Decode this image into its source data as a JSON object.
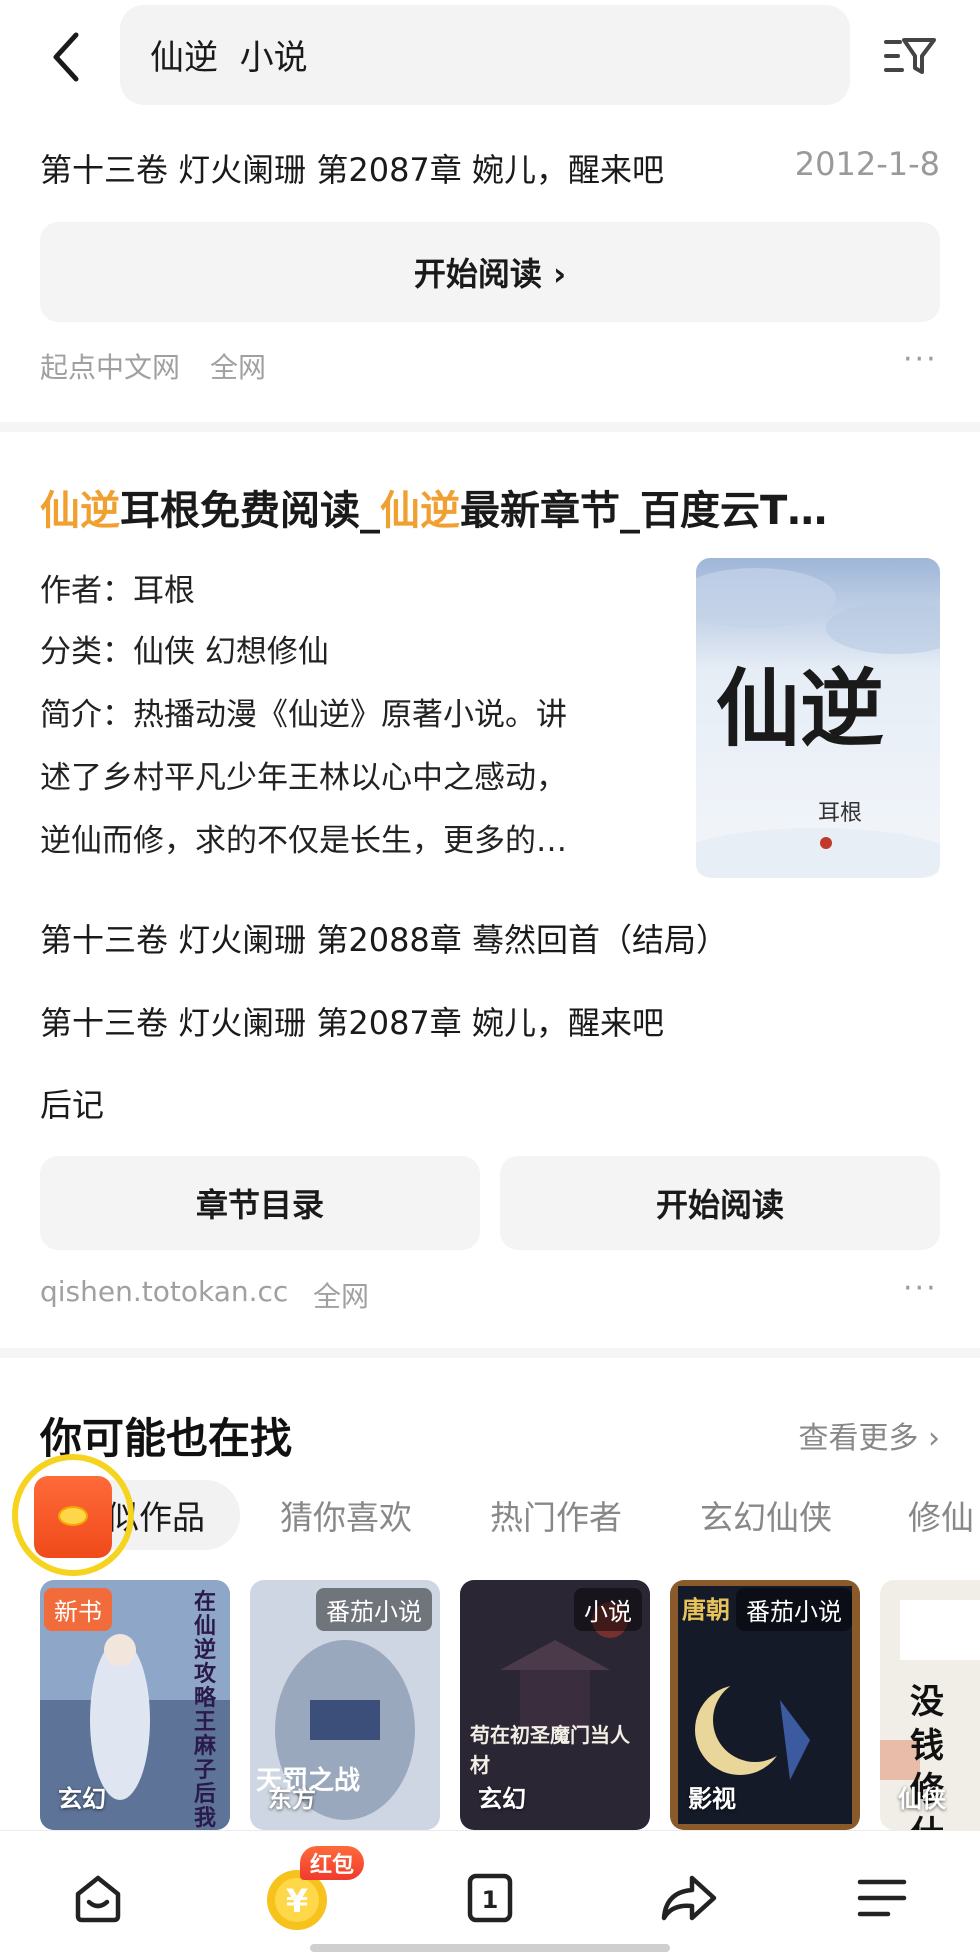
{
  "search": {
    "query": "仙逆  小说"
  },
  "result1": {
    "chapter": "第十三卷 灯火阑珊 第2087章 婉儿，醒来吧",
    "date": "2012-1-8",
    "read_button": "开始阅读 ›",
    "source": "起点中文网",
    "scope": "全网",
    "more": "···"
  },
  "result2": {
    "title_parts": [
      "仙逆",
      "耳根免费阅读_",
      "仙逆",
      "最新章节_百度云T…"
    ],
    "author_line": "作者：耳根",
    "category_line": "分类：仙侠 幻想修仙",
    "intro_lines": [
      "简介：热播动漫《仙逆》原著小说。讲",
      "述了乡村平凡少年王林以心中之感动，",
      "逆仙而修，求的不仅是长生，更多的…"
    ],
    "cover": {
      "title": "仙逆",
      "author": "耳根"
    },
    "chapters": [
      "第十三卷 灯火阑珊 第2088章 蓦然回首（结局）",
      "第十三卷 灯火阑珊 第2087章 婉儿，醒来吧",
      "后记"
    ],
    "toc_button": "章节目录",
    "read_button": "开始阅读",
    "source": "qishen.totokan.cc",
    "scope": "全网",
    "more": "···"
  },
  "recommend": {
    "title": "你可能也在找",
    "more": "查看更多 ›",
    "tags": [
      "似作品",
      "猜你喜欢",
      "热门作者",
      "玄幻仙侠",
      "修仙"
    ],
    "books": [
      {
        "badge": "新书",
        "genre": "玄幻",
        "art_text": "在仙逆攻略王麻子后我逆天了"
      },
      {
        "badge": "番茄小说",
        "genre": "东方",
        "art_text": "天罚之战"
      },
      {
        "badge": "小说",
        "genre": "玄幻",
        "art_text": "苟在初圣魔门当人材"
      },
      {
        "badge": "番茄小说",
        "genre": "影视",
        "art_text": "唐朝"
      },
      {
        "badge": "",
        "genre": "仙侠",
        "art_text": "没钱修什么"
      }
    ]
  },
  "bottom_nav": {
    "redpacket_badge": "红包",
    "tab_count": "1",
    "coin_symbol": "¥"
  },
  "colors": {
    "highlight": "#f0a030",
    "badge_red": "#f26b3a"
  }
}
